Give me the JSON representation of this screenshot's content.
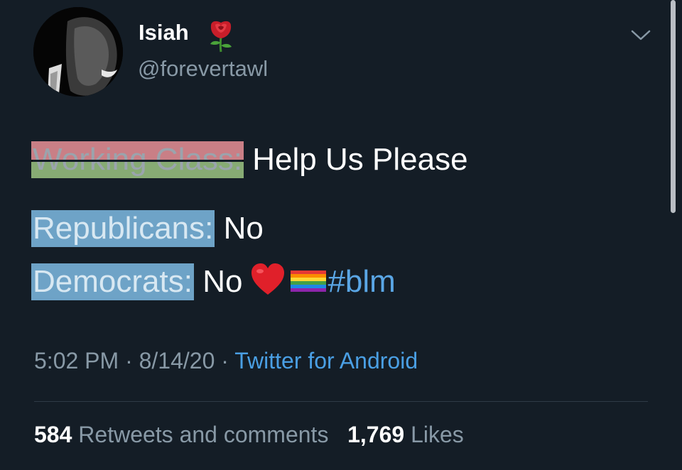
{
  "user": {
    "display_name": "Isiah",
    "handle": "@forevertawl",
    "name_emoji": "rose-icon",
    "avatar": "avatar-photo"
  },
  "tweet": {
    "line1_label": "Working Class:",
    "line1_text": "Help Us Please",
    "line2_label": "Republicans:",
    "line2_text": "No",
    "line3_label": "Democrats:",
    "line3_text": "No",
    "line3_emojis": [
      "heart-icon",
      "rainbow-flag-icon"
    ],
    "hashtag": "#blm"
  },
  "meta": {
    "time": "5:02 PM",
    "sep1": "·",
    "date": "8/14/20",
    "sep2": "·",
    "source": "Twitter for Android"
  },
  "stats": {
    "retweets_count": "584",
    "retweets_label": "Retweets and comments",
    "likes_count": "1,769",
    "likes_label": "Likes"
  },
  "colors": {
    "background": "#141d26",
    "secondary_text": "#8899a6",
    "link": "#4a9fe4",
    "label_highlight_blue": "#6ea3c7",
    "flag_red": "#c97f86",
    "flag_green": "#87ab74"
  }
}
